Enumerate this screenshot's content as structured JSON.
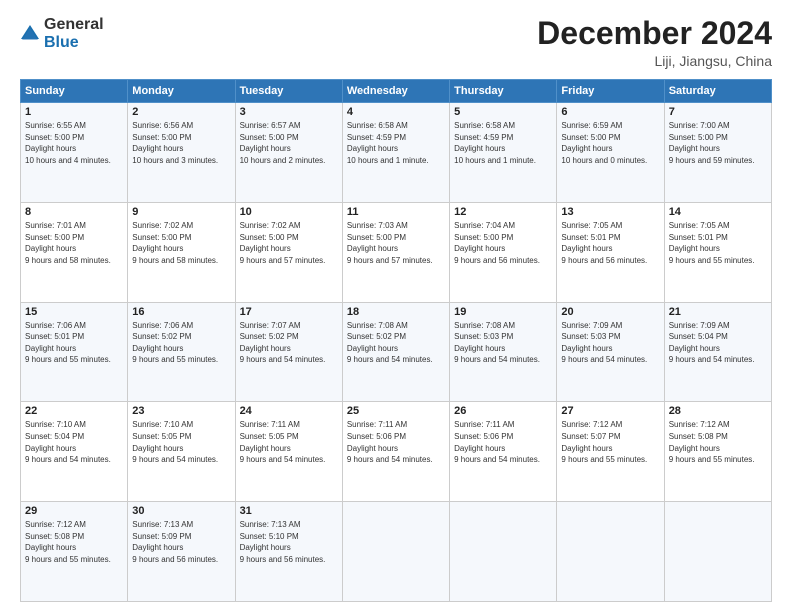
{
  "header": {
    "logo": {
      "general": "General",
      "blue": "Blue"
    },
    "title": "December 2024",
    "location": "Liji, Jiangsu, China"
  },
  "weekdays": [
    "Sunday",
    "Monday",
    "Tuesday",
    "Wednesday",
    "Thursday",
    "Friday",
    "Saturday"
  ],
  "weeks": [
    [
      {
        "day": "1",
        "sunrise": "6:55 AM",
        "sunset": "5:00 PM",
        "daylight": "10 hours and 4 minutes."
      },
      {
        "day": "2",
        "sunrise": "6:56 AM",
        "sunset": "5:00 PM",
        "daylight": "10 hours and 3 minutes."
      },
      {
        "day": "3",
        "sunrise": "6:57 AM",
        "sunset": "5:00 PM",
        "daylight": "10 hours and 2 minutes."
      },
      {
        "day": "4",
        "sunrise": "6:58 AM",
        "sunset": "4:59 PM",
        "daylight": "10 hours and 1 minute."
      },
      {
        "day": "5",
        "sunrise": "6:58 AM",
        "sunset": "4:59 PM",
        "daylight": "10 hours and 1 minute."
      },
      {
        "day": "6",
        "sunrise": "6:59 AM",
        "sunset": "5:00 PM",
        "daylight": "10 hours and 0 minutes."
      },
      {
        "day": "7",
        "sunrise": "7:00 AM",
        "sunset": "5:00 PM",
        "daylight": "9 hours and 59 minutes."
      }
    ],
    [
      {
        "day": "8",
        "sunrise": "7:01 AM",
        "sunset": "5:00 PM",
        "daylight": "9 hours and 58 minutes."
      },
      {
        "day": "9",
        "sunrise": "7:02 AM",
        "sunset": "5:00 PM",
        "daylight": "9 hours and 58 minutes."
      },
      {
        "day": "10",
        "sunrise": "7:02 AM",
        "sunset": "5:00 PM",
        "daylight": "9 hours and 57 minutes."
      },
      {
        "day": "11",
        "sunrise": "7:03 AM",
        "sunset": "5:00 PM",
        "daylight": "9 hours and 57 minutes."
      },
      {
        "day": "12",
        "sunrise": "7:04 AM",
        "sunset": "5:00 PM",
        "daylight": "9 hours and 56 minutes."
      },
      {
        "day": "13",
        "sunrise": "7:05 AM",
        "sunset": "5:01 PM",
        "daylight": "9 hours and 56 minutes."
      },
      {
        "day": "14",
        "sunrise": "7:05 AM",
        "sunset": "5:01 PM",
        "daylight": "9 hours and 55 minutes."
      }
    ],
    [
      {
        "day": "15",
        "sunrise": "7:06 AM",
        "sunset": "5:01 PM",
        "daylight": "9 hours and 55 minutes."
      },
      {
        "day": "16",
        "sunrise": "7:06 AM",
        "sunset": "5:02 PM",
        "daylight": "9 hours and 55 minutes."
      },
      {
        "day": "17",
        "sunrise": "7:07 AM",
        "sunset": "5:02 PM",
        "daylight": "9 hours and 54 minutes."
      },
      {
        "day": "18",
        "sunrise": "7:08 AM",
        "sunset": "5:02 PM",
        "daylight": "9 hours and 54 minutes."
      },
      {
        "day": "19",
        "sunrise": "7:08 AM",
        "sunset": "5:03 PM",
        "daylight": "9 hours and 54 minutes."
      },
      {
        "day": "20",
        "sunrise": "7:09 AM",
        "sunset": "5:03 PM",
        "daylight": "9 hours and 54 minutes."
      },
      {
        "day": "21",
        "sunrise": "7:09 AM",
        "sunset": "5:04 PM",
        "daylight": "9 hours and 54 minutes."
      }
    ],
    [
      {
        "day": "22",
        "sunrise": "7:10 AM",
        "sunset": "5:04 PM",
        "daylight": "9 hours and 54 minutes."
      },
      {
        "day": "23",
        "sunrise": "7:10 AM",
        "sunset": "5:05 PM",
        "daylight": "9 hours and 54 minutes."
      },
      {
        "day": "24",
        "sunrise": "7:11 AM",
        "sunset": "5:05 PM",
        "daylight": "9 hours and 54 minutes."
      },
      {
        "day": "25",
        "sunrise": "7:11 AM",
        "sunset": "5:06 PM",
        "daylight": "9 hours and 54 minutes."
      },
      {
        "day": "26",
        "sunrise": "7:11 AM",
        "sunset": "5:06 PM",
        "daylight": "9 hours and 54 minutes."
      },
      {
        "day": "27",
        "sunrise": "7:12 AM",
        "sunset": "5:07 PM",
        "daylight": "9 hours and 55 minutes."
      },
      {
        "day": "28",
        "sunrise": "7:12 AM",
        "sunset": "5:08 PM",
        "daylight": "9 hours and 55 minutes."
      }
    ],
    [
      {
        "day": "29",
        "sunrise": "7:12 AM",
        "sunset": "5:08 PM",
        "daylight": "9 hours and 55 minutes."
      },
      {
        "day": "30",
        "sunrise": "7:13 AM",
        "sunset": "5:09 PM",
        "daylight": "9 hours and 56 minutes."
      },
      {
        "day": "31",
        "sunrise": "7:13 AM",
        "sunset": "5:10 PM",
        "daylight": "9 hours and 56 minutes."
      },
      null,
      null,
      null,
      null
    ]
  ]
}
